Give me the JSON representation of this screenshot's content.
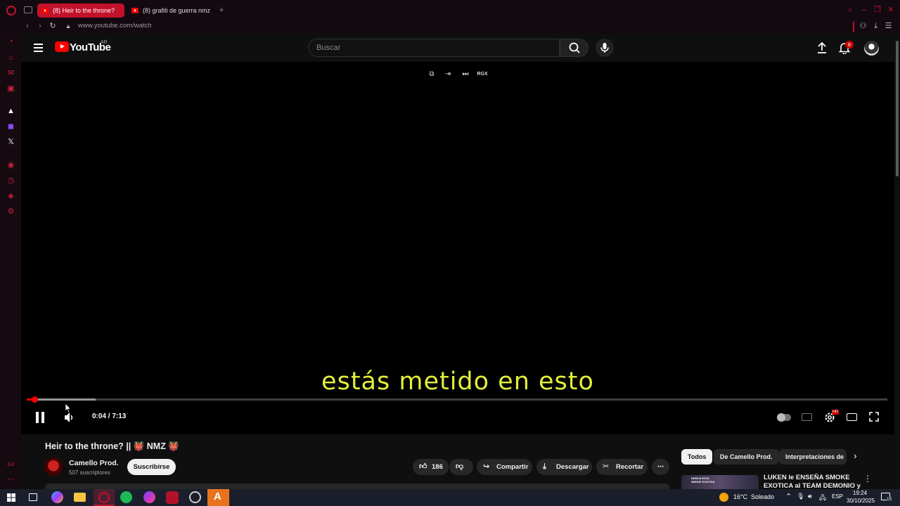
{
  "browser": {
    "tabs": [
      {
        "title": "(8) Heir to the throne?",
        "active": true
      },
      {
        "title": "(8) grafiti de guerra nmz",
        "active": false
      }
    ],
    "address": "www.youtube.com/watch",
    "icons": {
      "menu": "opera-logo-icon",
      "tab-manager": "tabs-icon",
      "new-tab": "plus-icon",
      "search": "search-icon"
    }
  },
  "youtube": {
    "logo_text": "YouTube",
    "country": "AR",
    "search_placeholder": "Buscar",
    "notification_count": "8",
    "video": {
      "caption": "estás metido en esto",
      "current_time": "0:04",
      "duration": "7:13",
      "time_display": "0:04 / 7:13",
      "progress_fraction": 0.0092,
      "buffered_fraction": 0.08,
      "quality_badge": "HD",
      "overlay_label": "RGX"
    },
    "title": "Heir to the throne? || 👹 NMZ 👹",
    "channel": {
      "name": "Camello Prod.",
      "subscribers": "507 suscriptores",
      "subscribe_label": "Suscribirse"
    },
    "actions": {
      "likes": "186",
      "share": "Compartir",
      "download": "Descargar",
      "clip": "Recortar"
    },
    "chips": [
      "Todos",
      "De Camello Prod.",
      "Interpretaciones de"
    ],
    "recommended": {
      "title": "LUKEN le ENSEÑA SMOKE EXOTICA al TEAM DEMONIO y",
      "thumb_text": "NUNCA ESTA SMOKE EXOTICA"
    }
  },
  "taskbar": {
    "weather_temp": "16°C",
    "weather_desc": "Soleado",
    "lang": "ESP",
    "time": "19:24",
    "date": "30/10/2025",
    "notifications": "15"
  },
  "colors": {
    "opera_red": "#c2122b",
    "yt_red": "#ff0000",
    "caption": "#e3ee3a"
  }
}
